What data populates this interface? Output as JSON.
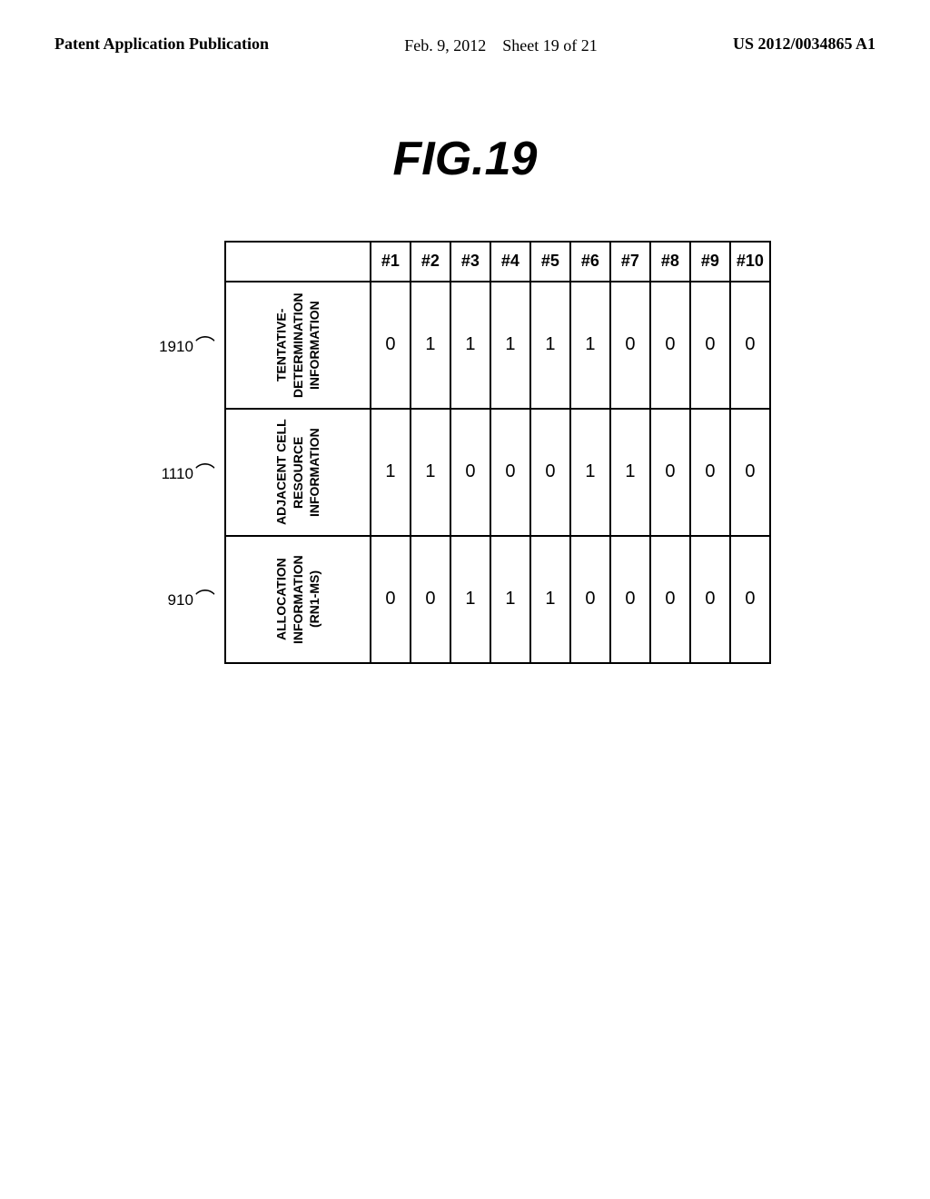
{
  "header": {
    "left": "Patent Application Publication",
    "center_date": "Feb. 9, 2012",
    "center_sheet": "Sheet 19 of 21",
    "right": "US 2012/0034865 A1"
  },
  "figure": {
    "title": "FIG.19"
  },
  "table": {
    "column_headers": [
      "#1",
      "#2",
      "#3",
      "#4",
      "#5",
      "#6",
      "#7",
      "#8",
      "#9",
      "#10"
    ],
    "rows": [
      {
        "label": "TENTATIVE-DETERMINATION\nINFORMATION",
        "ref": "1910",
        "values": [
          "0",
          "1",
          "1",
          "1",
          "1",
          "1",
          "0",
          "0",
          "0",
          "0"
        ]
      },
      {
        "label": "ADJACENT CELL RESOURCE\nINFORMATION",
        "ref": "1110",
        "values": [
          "1",
          "1",
          "0",
          "0",
          "0",
          "1",
          "1",
          "0",
          "0",
          "0"
        ]
      },
      {
        "label": "ALLOCATION INFORMATION\n(RN1-MS)",
        "ref": "910",
        "values": [
          "0",
          "0",
          "1",
          "1",
          "1",
          "0",
          "0",
          "0",
          "0",
          "0"
        ]
      }
    ]
  }
}
